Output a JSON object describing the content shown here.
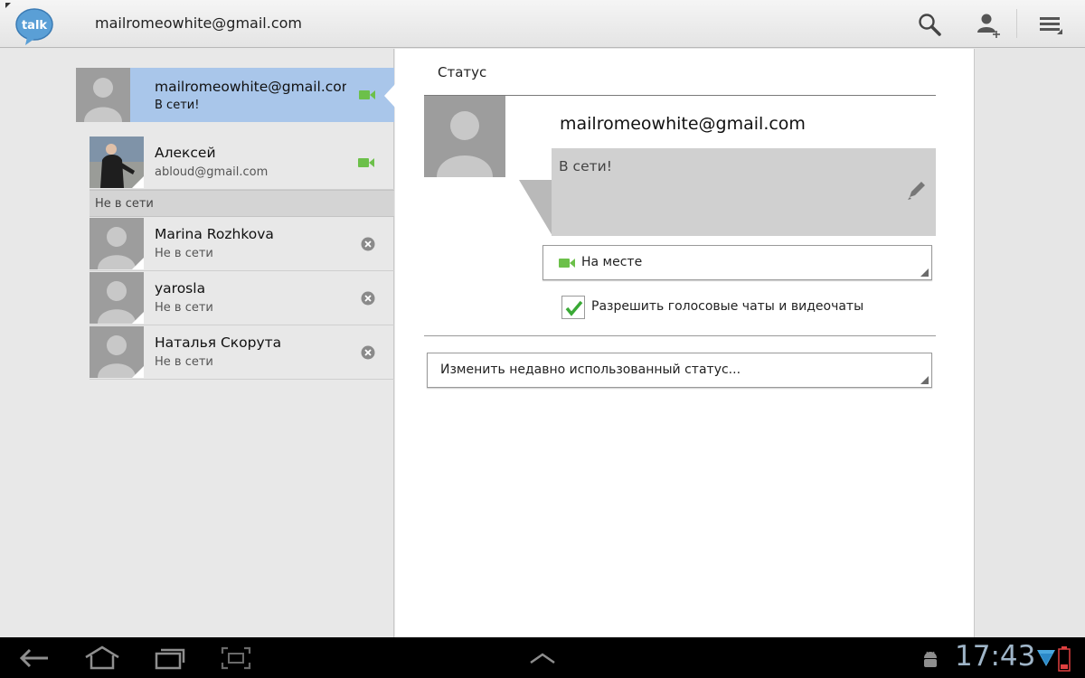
{
  "header": {
    "app_logo_text": "talk",
    "account_email": "mailromeowhite@gmail.com"
  },
  "self": {
    "name": "mailromeowhite@gmail.com",
    "status": "В сети!"
  },
  "contacts_online": [
    {
      "name": "Алексей",
      "sub": "abloud@gmail.com",
      "status_icon": "video-camera-icon"
    }
  ],
  "offline_section": "Не в сети",
  "contacts_offline": [
    {
      "name": "Marina Rozhkova",
      "sub": "Не в сети",
      "status_icon": "offline-icon"
    },
    {
      "name": "yarosla",
      "sub": "Не в сети",
      "status_icon": "offline-icon"
    },
    {
      "name": "Наталья Скорута",
      "sub": "Не в сети",
      "status_icon": "offline-icon"
    }
  ],
  "status_panel": {
    "title": "Статус",
    "email": "mailromeowhite@gmail.com",
    "status_message": "В сети!",
    "presence_value": "На месте",
    "allow_chats_label": "Разрешить голосовые чаты и видеочаты",
    "allow_chats_checked": true,
    "recent_status_label": "Изменить недавно использованный статус..."
  },
  "system_bar": {
    "clock": "17:43"
  },
  "colors": {
    "selected_row": "#a9c6ea",
    "online_green": "#6cc04a",
    "check_green": "#39a935"
  }
}
